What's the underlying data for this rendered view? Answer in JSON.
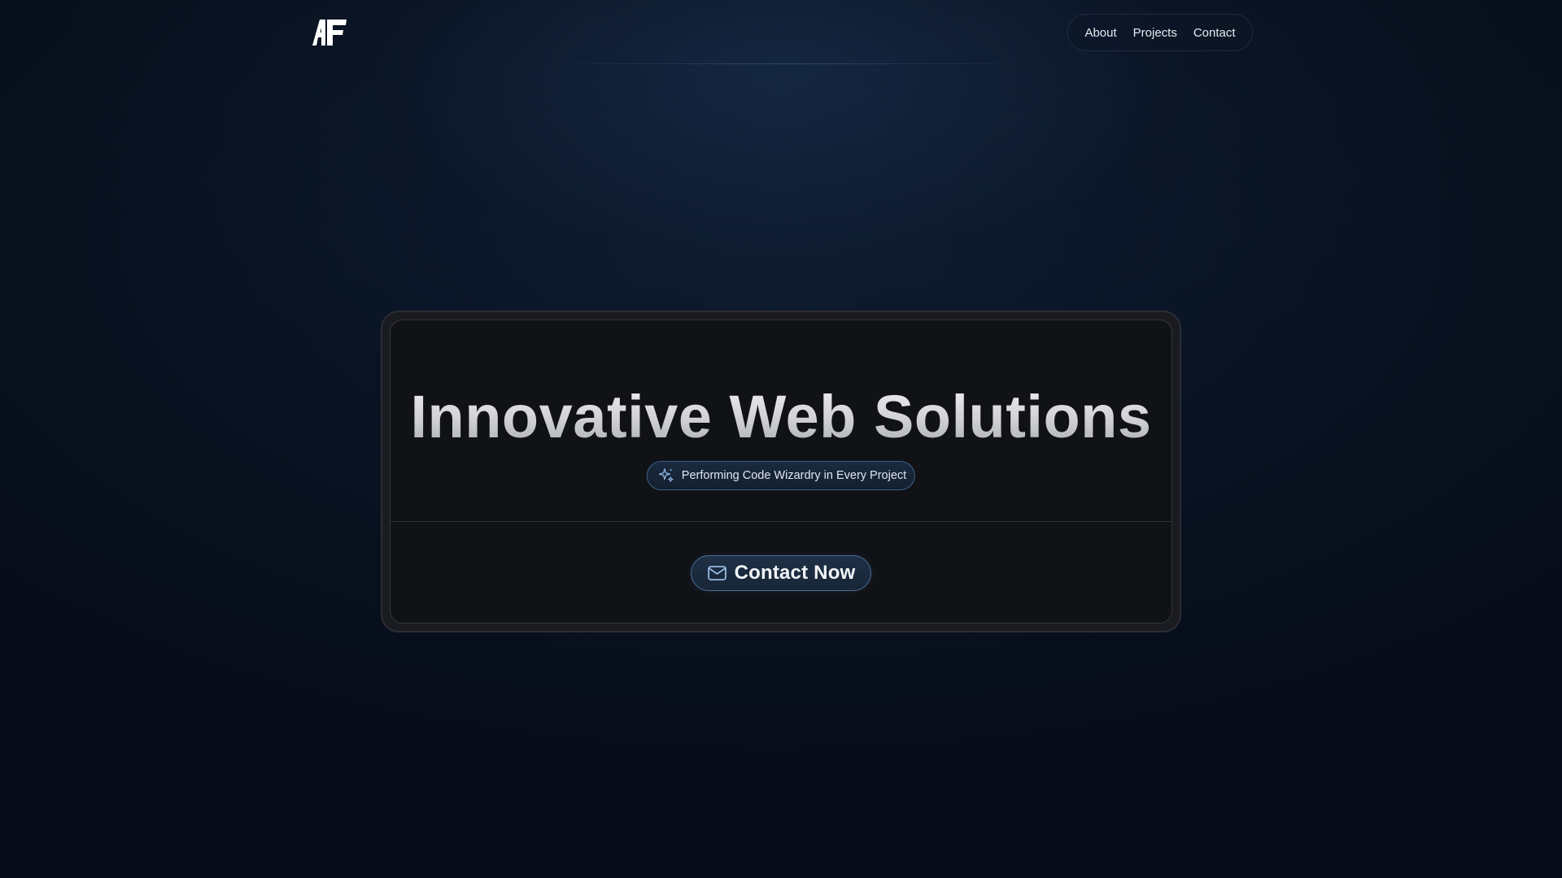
{
  "brand": {
    "logo_text": "AF",
    "logo_icon": "af-monogram-logo"
  },
  "nav": {
    "items": [
      {
        "label": "About"
      },
      {
        "label": "Projects"
      },
      {
        "label": "Contact"
      }
    ]
  },
  "hero": {
    "title": "Innovative Web Solutions",
    "tagline": {
      "icon": "sparkles-icon",
      "text": "Performing Code Wizardry in Every Project"
    },
    "cta": {
      "icon": "mail-icon",
      "label": "Contact Now"
    }
  },
  "colors": {
    "background": "#08111f",
    "card_background": "#111216",
    "accent_border": "#4a6f96",
    "sparkle": "#8fb6e6"
  }
}
